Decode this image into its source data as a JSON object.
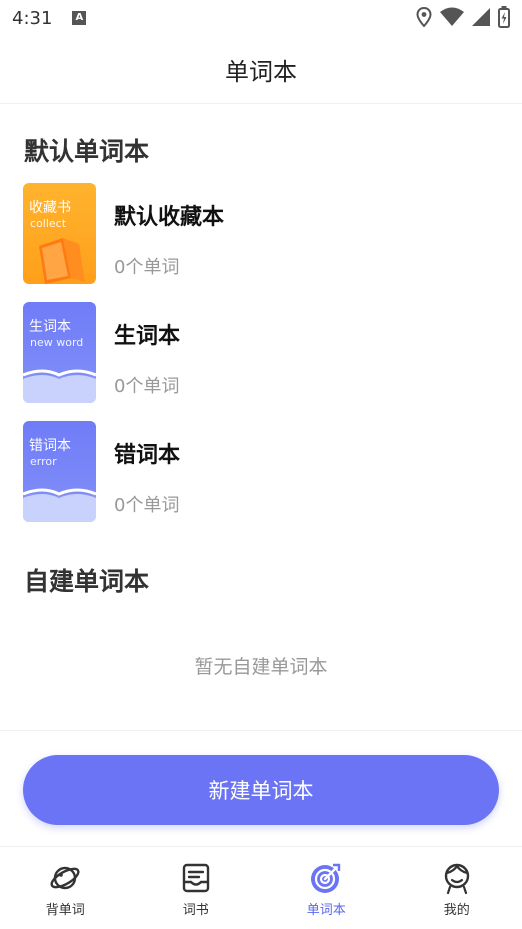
{
  "status_bar": {
    "time": "4:31",
    "notification_icon": "a-icon"
  },
  "header": {
    "title": "单词本"
  },
  "default_section": {
    "title": "默认单词本"
  },
  "books": [
    {
      "name": "默认收藏本",
      "count": "0个单词",
      "cover_title": "收藏书",
      "cover_sub": "collect",
      "cover_color": "#ffa824"
    },
    {
      "name": "生词本",
      "count": "0个单词",
      "cover_title": "生词本",
      "cover_sub": "new word",
      "cover_color": "#6f7cf7"
    },
    {
      "name": "错词本",
      "count": "0个单词",
      "cover_title": "错词本",
      "cover_sub": "error",
      "cover_color": "#6f7cf7"
    }
  ],
  "custom_section": {
    "title": "自建单词本",
    "empty_text": "暂无自建单词本"
  },
  "create_button": {
    "label": "新建单词本",
    "color": "#6b74f5"
  },
  "tabs": [
    {
      "label": "背单词",
      "icon": "planet-icon",
      "active": false
    },
    {
      "label": "词书",
      "icon": "book-icon",
      "active": false
    },
    {
      "label": "单词本",
      "icon": "target-icon",
      "active": true
    },
    {
      "label": "我的",
      "icon": "user-icon",
      "active": false
    }
  ],
  "accent_color": "#5b66f0"
}
